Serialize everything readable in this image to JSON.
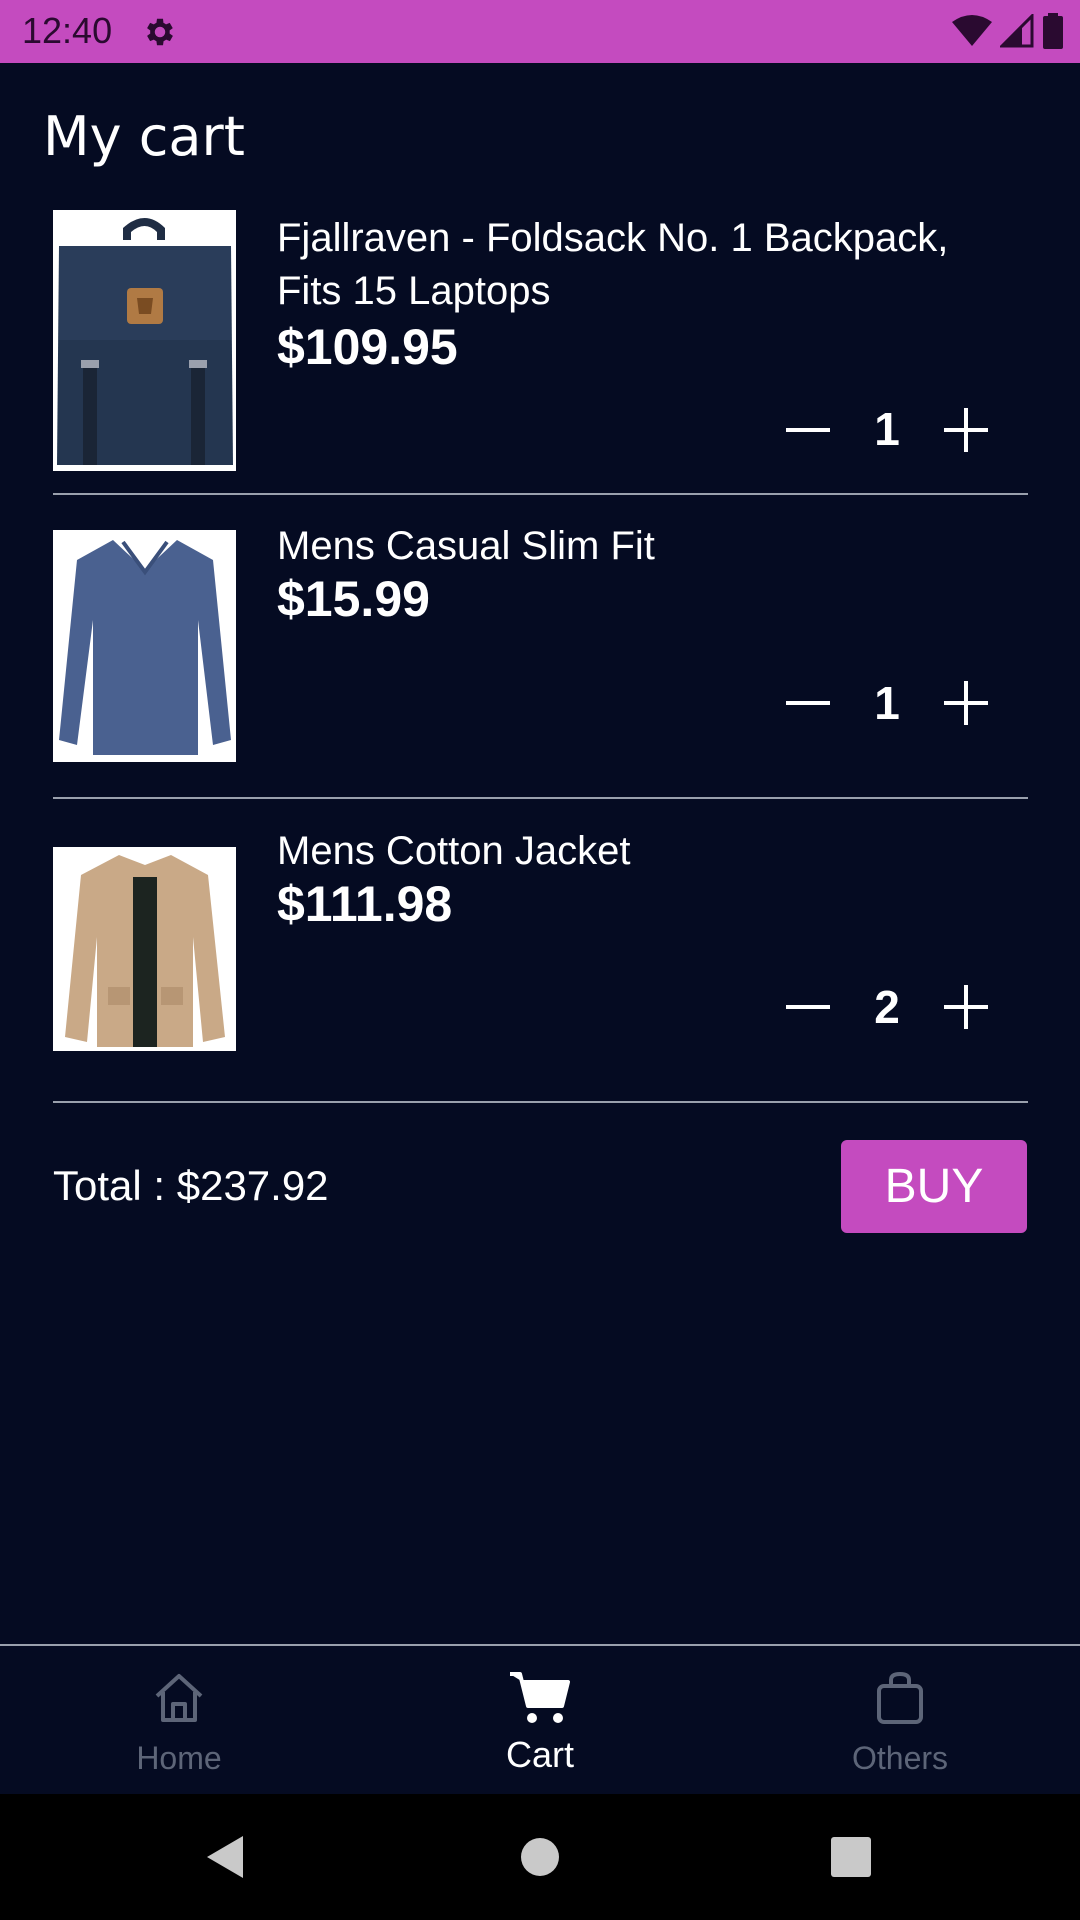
{
  "status_bar": {
    "time": "12:40",
    "icons": [
      "gear-icon",
      "wifi-icon",
      "signal-icon",
      "battery-icon"
    ],
    "background": "#c44bbf"
  },
  "header": {
    "title": "My cart"
  },
  "cart": {
    "items": [
      {
        "name": "Fjallraven - Foldsack No. 1 Backpack, Fits 15 Laptops",
        "price": "$109.95",
        "quantity": "1"
      },
      {
        "name": "Mens Casual Slim Fit",
        "price": "$15.99",
        "quantity": "1"
      },
      {
        "name": "Mens Cotton Jacket",
        "price": "$111.98",
        "quantity": "2"
      }
    ],
    "total_label": "Total : $237.92",
    "buy_label": "BUY"
  },
  "bottom_nav": {
    "items": [
      {
        "label": "Home",
        "icon": "home-icon",
        "active": false
      },
      {
        "label": "Cart",
        "icon": "cart-icon",
        "active": true
      },
      {
        "label": "Others",
        "icon": "shopping-bag-icon",
        "active": false
      }
    ]
  },
  "system_nav": {
    "icons": [
      "back-icon",
      "home-circle-icon",
      "recents-icon"
    ]
  },
  "colors": {
    "background": "#050b22",
    "accent": "#c44bbf",
    "inactive": "#5d6578"
  }
}
